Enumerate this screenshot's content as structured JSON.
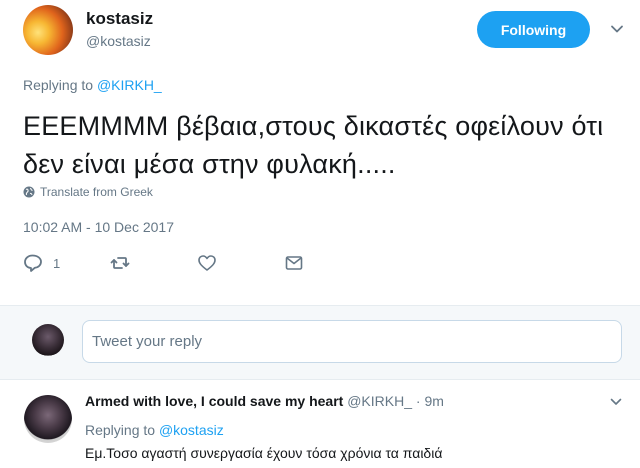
{
  "tweet": {
    "name": "kostasiz",
    "handle": "@kostasiz",
    "follow_label": "Following",
    "replying_prefix": "Replying to",
    "replying_mention": "@KIRKH_",
    "text": "ΕΕΕΜΜΜΜ βέβαια,στους δικαστές οφείλουν ότι δεν είναι μέσα στην φυλακή.....",
    "translate_label": "Translate from Greek",
    "timestamp": "10:02 AM - 10 Dec 2017",
    "reply_count": "1",
    "accent_color": "#1da1f2",
    "icons": [
      "chevron-down-icon",
      "globe-icon",
      "reply-icon",
      "retweet-icon",
      "like-icon",
      "direct-message-icon"
    ]
  },
  "composer": {
    "placeholder": "Tweet your reply"
  },
  "reply": {
    "name": "Armed with love, I could save my heart",
    "handle": "@KIRKH_",
    "separator": "·",
    "time": "9m",
    "replying_prefix": "Replying to",
    "replying_mention": "@kostasiz",
    "text": "Εμ.Τοσο αγαστή συνεργασία έχουν τόσα χρόνια τα παιδιά"
  }
}
